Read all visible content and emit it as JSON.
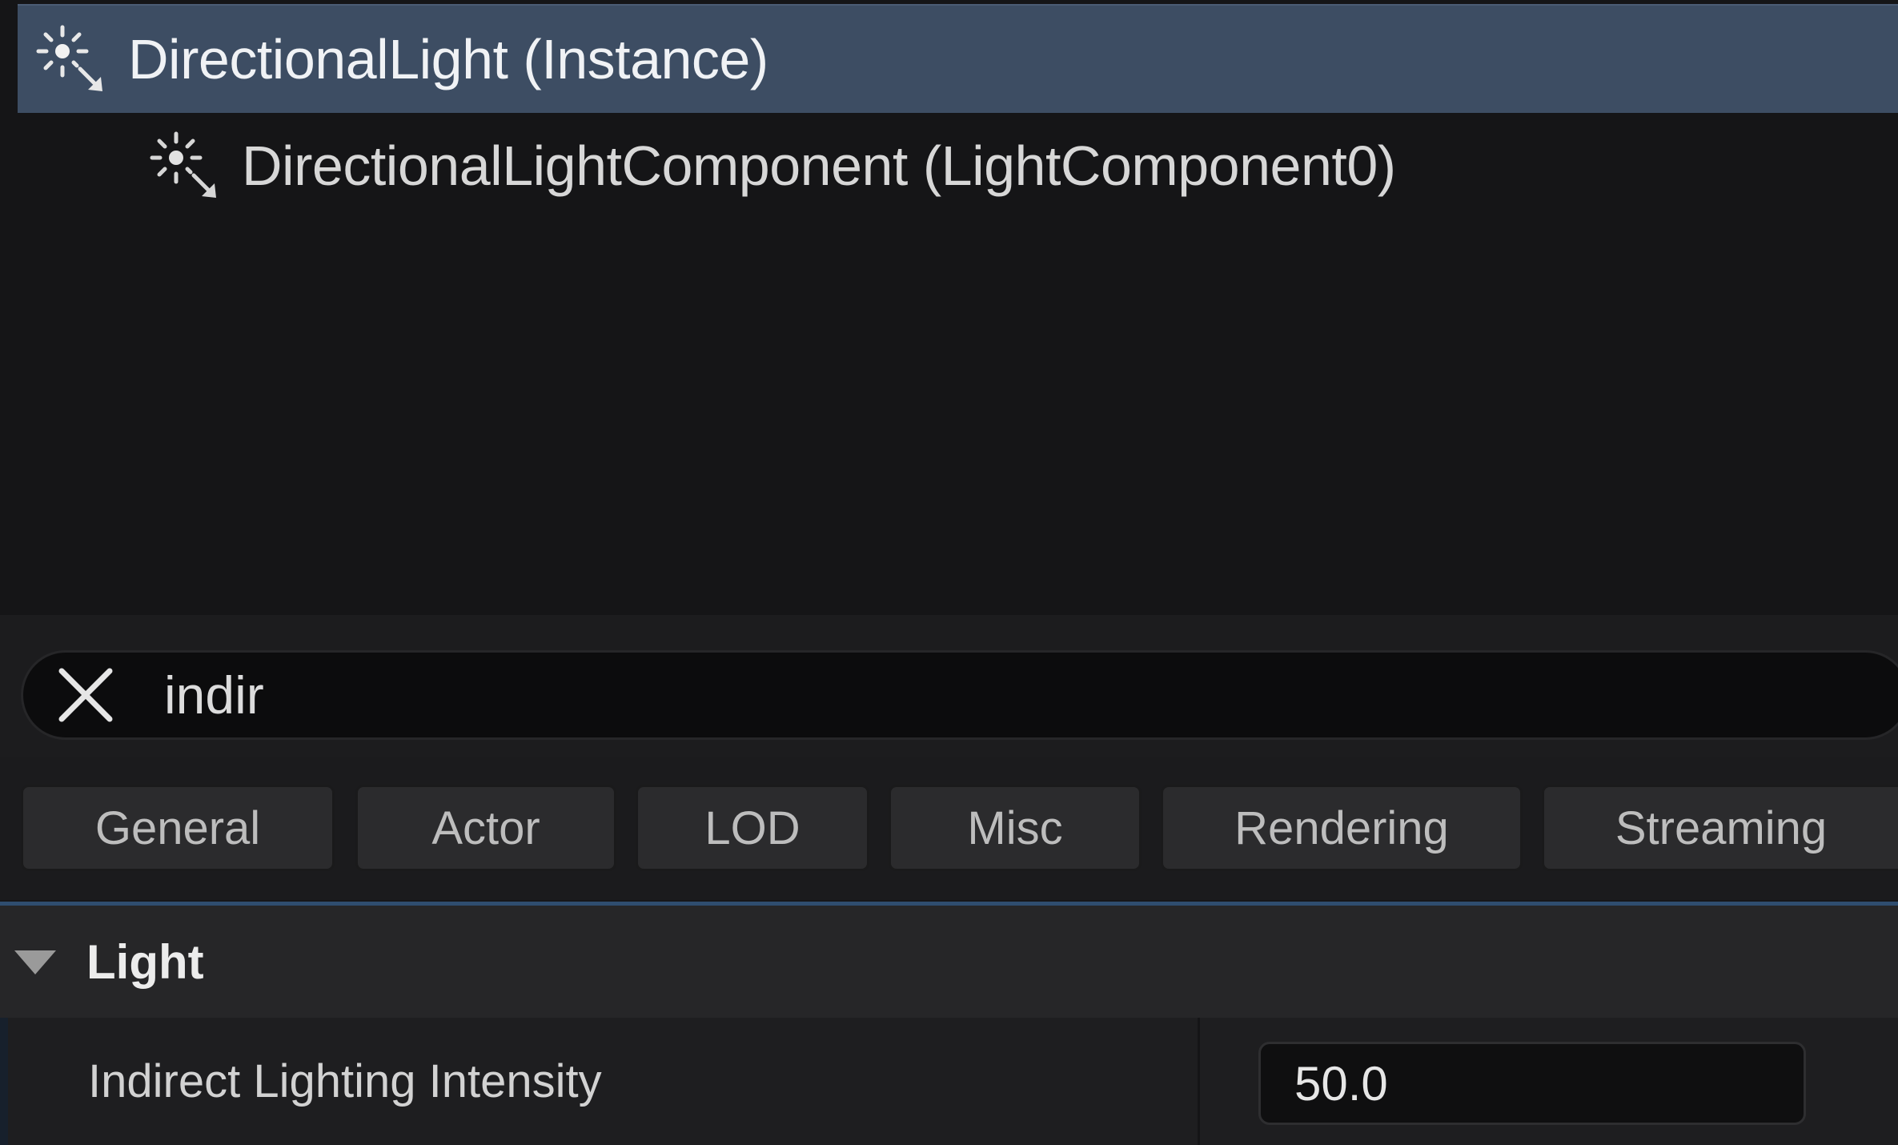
{
  "tree": {
    "root_label": "DirectionalLight (Instance)",
    "root_icon": "directional-light-icon",
    "child_label": "DirectionalLightComponent (LightComponent0)",
    "child_icon": "directional-light-icon"
  },
  "search": {
    "value": "indir",
    "clear_icon": "close-icon"
  },
  "filters": [
    "General",
    "Actor",
    "LOD",
    "Misc",
    "Rendering",
    "Streaming"
  ],
  "section": {
    "title": "Light",
    "expanded": true,
    "arrow_icon": "caret-down-icon",
    "properties": [
      {
        "label": "Indirect Lighting Intensity",
        "value": "50.0"
      }
    ]
  },
  "colors": {
    "selection": "#3d4d63",
    "accent_divider": "#2f4d6f",
    "background": "#161618"
  }
}
